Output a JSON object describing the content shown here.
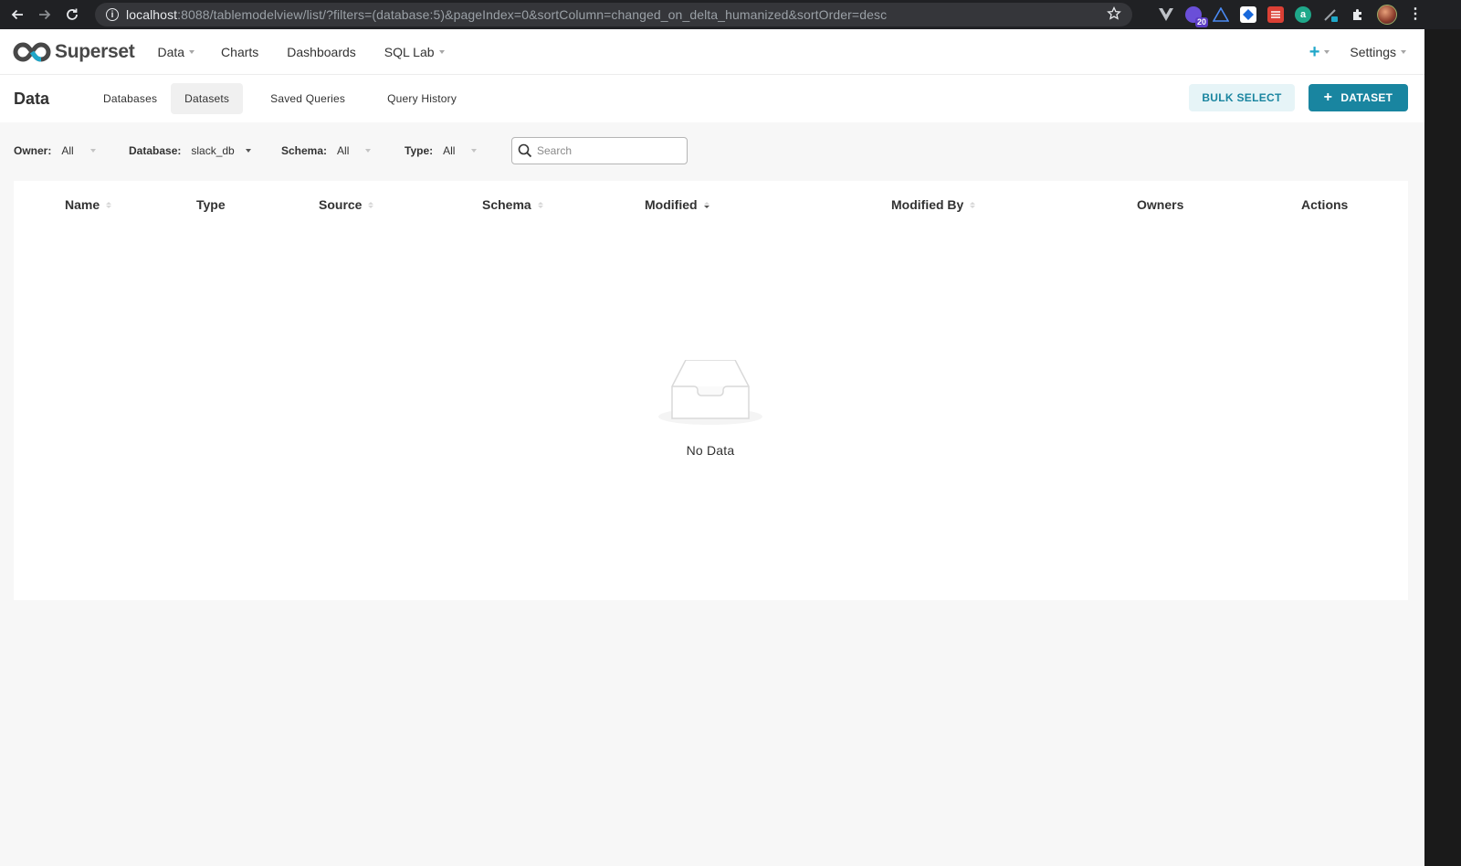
{
  "browser": {
    "url_host": "localhost",
    "url_rest": ":8088/tablemodelview/list/?filters=(database:5)&pageIndex=0&sortColumn=changed_on_delta_humanized&sortOrder=desc",
    "extension_badge": "20"
  },
  "app": {
    "brand": "Superset",
    "menu": {
      "data": "Data",
      "charts": "Charts",
      "dashboards": "Dashboards",
      "sql_lab": "SQL Lab"
    },
    "settings": "Settings",
    "plus": "+"
  },
  "sub_header": {
    "title": "Data",
    "tabs": [
      "Databases",
      "Datasets",
      "Saved Queries",
      "Query History"
    ],
    "active_tab": "Datasets",
    "bulk_select": "BULK SELECT",
    "add_dataset": "DATASET",
    "add_dataset_plus": "+"
  },
  "filters": {
    "owner": {
      "label": "Owner:",
      "value": "All"
    },
    "database": {
      "label": "Database:",
      "value": "slack_db"
    },
    "schema": {
      "label": "Schema:",
      "value": "All"
    },
    "type": {
      "label": "Type:",
      "value": "All"
    },
    "search_placeholder": "Search"
  },
  "table": {
    "columns": [
      "Name",
      "Type",
      "Source",
      "Schema",
      "Modified",
      "Modified By",
      "Owners",
      "Actions"
    ],
    "sorted_column": "Modified",
    "sort_order": "desc",
    "empty_text": "No Data"
  },
  "colors": {
    "primary": "#1985a0",
    "accent": "#20a7c9",
    "bulk_bg": "#e6f4f7"
  }
}
